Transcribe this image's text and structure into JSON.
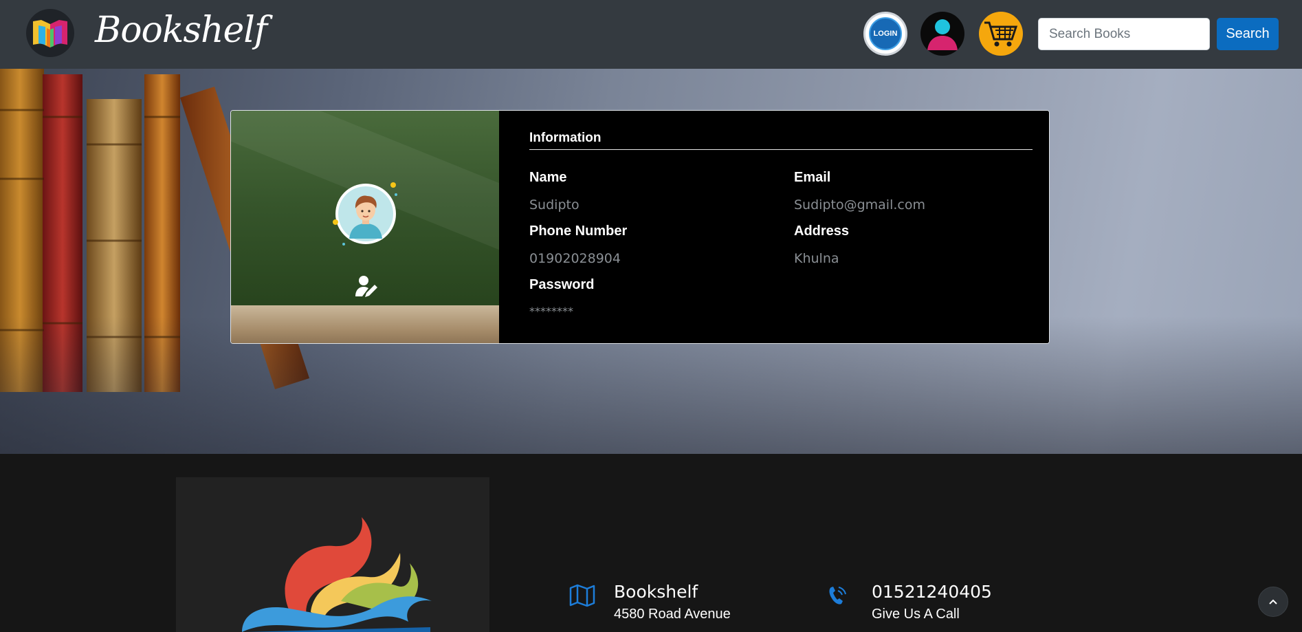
{
  "navbar": {
    "brand": "Bookshelf",
    "login_label": "LOGIN",
    "search": {
      "placeholder": "Search Books",
      "value": ""
    },
    "search_button": "Search",
    "colors": {
      "background": "#343a40",
      "accent": "#0b6cc0",
      "cart": "#f5a70d"
    }
  },
  "profile": {
    "section_title": "Information",
    "fields": [
      {
        "label": "Name",
        "value": "Sudipto"
      },
      {
        "label": "Email",
        "value": "Sudipto@gmail.com"
      },
      {
        "label": "Phone Number",
        "value": "01902028904"
      },
      {
        "label": "Address",
        "value": "Khulna"
      },
      {
        "label": "Password",
        "value": "********"
      }
    ],
    "icons": [
      "user-avatar-icon",
      "user-edit-icon"
    ]
  },
  "footer": {
    "address": {
      "title": "Bookshelf",
      "subtitle": "4580 Road Avenue",
      "icon": "map-icon"
    },
    "phone": {
      "title": "01521240405",
      "subtitle": "Give Us A Call",
      "icon": "phone-icon"
    },
    "colors": {
      "icon": "#1d7dd9",
      "background": "#161616"
    }
  },
  "scroll_top": {
    "icon": "chevron-up-icon"
  }
}
